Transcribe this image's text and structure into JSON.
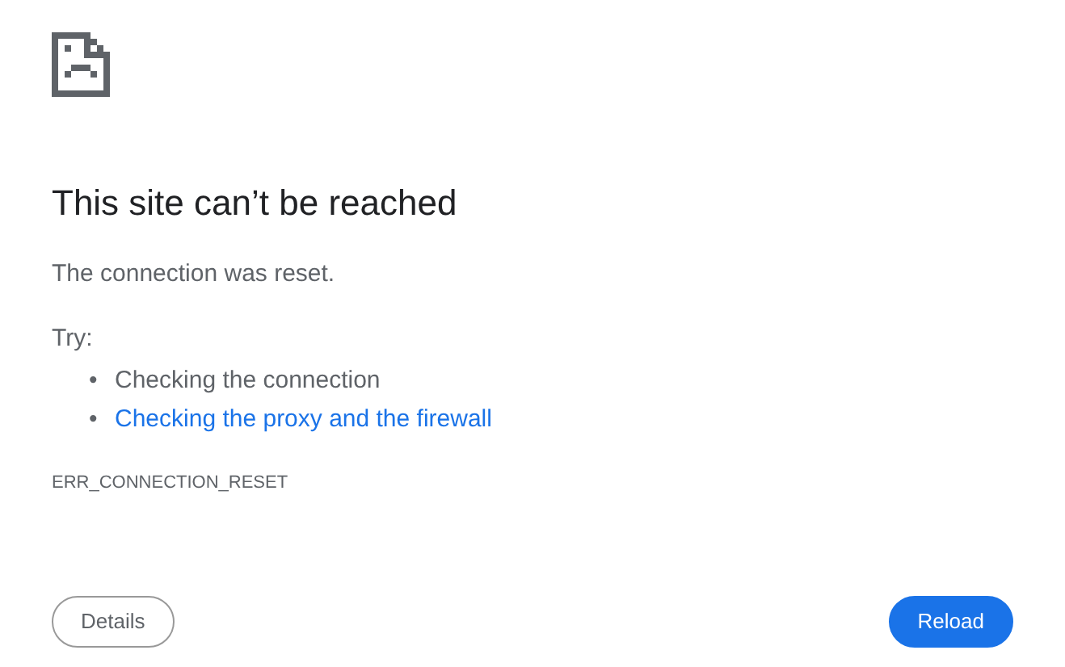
{
  "heading": "This site can’t be reached",
  "message": "The connection was reset.",
  "suggestions_label": "Try:",
  "suggestions": [
    {
      "kind": "text",
      "marker": "•",
      "text": "Checking the connection"
    },
    {
      "kind": "link",
      "marker": "•",
      "text": "Checking the proxy and the firewall"
    }
  ],
  "error_code": "ERR_CONNECTION_RESET",
  "buttons": [
    {
      "kind": "secondary",
      "label": "Details"
    },
    {
      "kind": "primary",
      "label": "Reload"
    }
  ]
}
